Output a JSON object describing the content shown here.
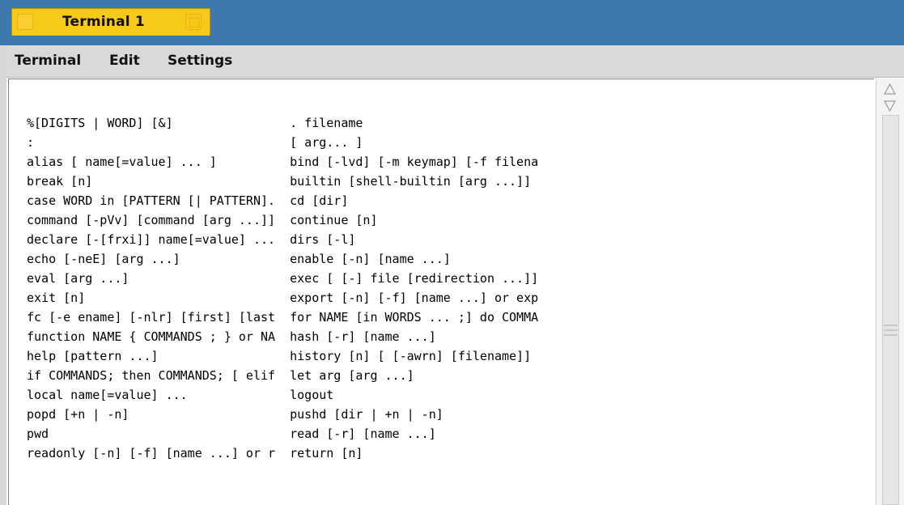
{
  "window": {
    "tab_title": "Terminal 1"
  },
  "menu": {
    "items": [
      "Terminal",
      "Edit",
      "Settings"
    ]
  },
  "terminal": {
    "lines": [
      "%[DIGITS | WORD] [&]                . filename",
      ":                                   [ arg... ]",
      "alias [ name[=value] ... ]          bind [-lvd] [-m keymap] [-f filena",
      "break [n]                           builtin [shell-builtin [arg ...]]",
      "case WORD in [PATTERN [| PATTERN].  cd [dir]",
      "command [-pVv] [command [arg ...]]  continue [n]",
      "declare [-[frxi]] name[=value] ...  dirs [-l]",
      "echo [-neE] [arg ...]               enable [-n] [name ...]",
      "eval [arg ...]                      exec [ [-] file [redirection ...]]",
      "exit [n]                            export [-n] [-f] [name ...] or exp",
      "fc [-e ename] [-nlr] [first] [last  for NAME [in WORDS ... ;] do COMMA",
      "function NAME { COMMANDS ; } or NA  hash [-r] [name ...]",
      "help [pattern ...]                  history [n] [ [-awrn] [filename]]",
      "if COMMANDS; then COMMANDS; [ elif  let arg [arg ...]",
      "local name[=value] ...              logout",
      "popd [+n | -n]                      pushd [dir | +n | -n]",
      "pwd                                 read [-r] [name ...]",
      "readonly [-n] [-f] [name ...] or r  return [n]"
    ]
  },
  "scrollbar": {
    "up_icon": "arrow-up-icon",
    "down_icon": "arrow-down-icon"
  },
  "colors": {
    "titlebar": "#3e78ae",
    "tab": "#f7c919",
    "menubar": "#d9d9d9"
  }
}
